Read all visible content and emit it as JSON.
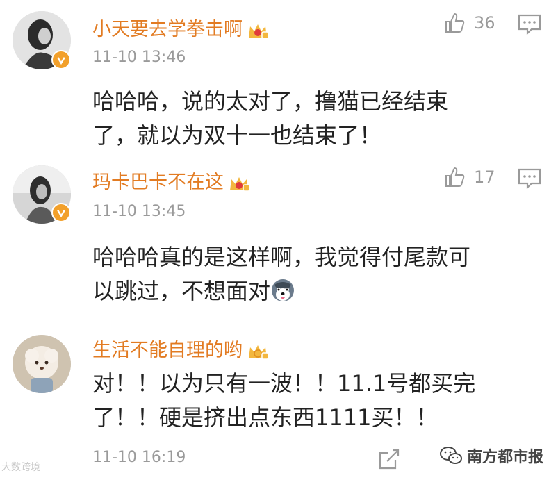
{
  "comments": [
    {
      "username": "小天要去学拳击啊",
      "timestamp": "11-10 13:46",
      "text": "哈哈哈，说的太对了，撸猫已经结束\n了，就以为双十一也结束了！",
      "likes": "36"
    },
    {
      "username": "玛卡巴卡不在这",
      "timestamp": "11-10 13:45",
      "text": "哈哈哈真的是这样啊，我觉得付尾款可\n以跳过，不想面对",
      "likes": "17",
      "emoji": "husky-face"
    },
    {
      "username": "生活不能自理的哟",
      "timestamp": "11-10 16:19",
      "text": "对！！以为只有一波！！11.1号都买完\n了！！硬是挤出点东西1111买！！"
    }
  ],
  "watermark_left": "大数跨境",
  "watermark_right": "南方都市报",
  "colors": {
    "username": "#e27b22",
    "meta": "#9a9a9a",
    "text": "#222222",
    "badge": "#f2a02b"
  }
}
